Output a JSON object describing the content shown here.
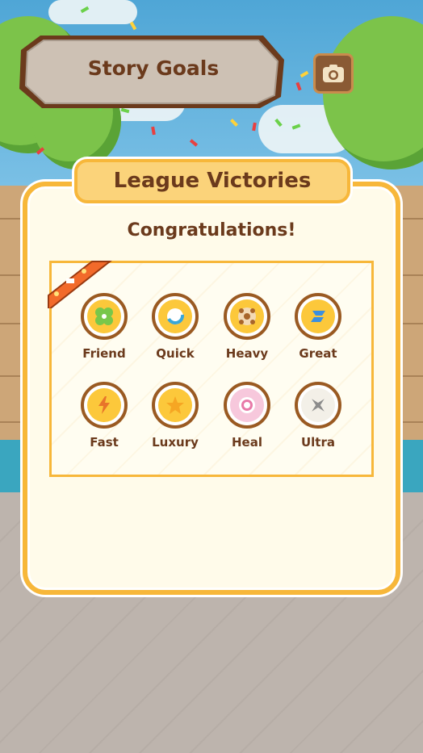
{
  "story": {
    "title": "Story Goals",
    "camera_icon": "camera-icon"
  },
  "dialog": {
    "header": "League Victories",
    "message": "Congratulations!",
    "ribbon_icon": "crown-stars-icon"
  },
  "medals": [
    {
      "label": "Friend",
      "icon": "clover-icon",
      "accent": "#78c74a"
    },
    {
      "label": "Quick",
      "icon": "swirl-icon",
      "accent": "#3aa6d8"
    },
    {
      "label": "Heavy",
      "icon": "cross-dots-icon",
      "accent": "#a8652b"
    },
    {
      "label": "Great",
      "icon": "lightning-stripes-icon",
      "accent": "#3a8fe0"
    },
    {
      "label": "Fast",
      "icon": "bolt-icon",
      "accent": "#e8742a"
    },
    {
      "label": "Luxury",
      "icon": "star-icon",
      "accent": "#f6a623"
    },
    {
      "label": "Heal",
      "icon": "target-heart-icon",
      "accent": "#e87aa8"
    },
    {
      "label": "Ultra",
      "icon": "shuriken-icon",
      "accent": "#8c8c8c"
    }
  ],
  "colors": {
    "frame": "#f7b73a",
    "text": "#6b3a1c",
    "panel": "#fffbea"
  }
}
